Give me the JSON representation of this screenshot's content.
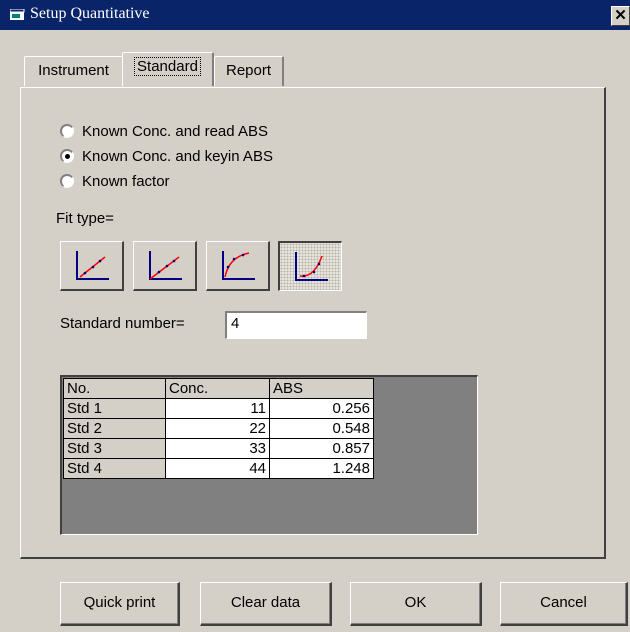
{
  "window": {
    "title": "Setup Quantitative",
    "close_symbol": "✕"
  },
  "tabs": [
    {
      "label": "Instrument",
      "active": false
    },
    {
      "label": "Standard",
      "active": true
    },
    {
      "label": "Report",
      "active": false
    }
  ],
  "mode_options": [
    {
      "label": "Known Conc. and read ABS",
      "checked": false
    },
    {
      "label": "Known Conc. and keyin ABS",
      "checked": true
    },
    {
      "label": "Known factor",
      "checked": false
    }
  ],
  "fit_type": {
    "label": "Fit type=",
    "buttons": [
      {
        "icon": "linear-fit-icon",
        "pressed": false
      },
      {
        "icon": "linear-through-origin-fit-icon",
        "pressed": false
      },
      {
        "icon": "quadratic-fit-icon",
        "pressed": false
      },
      {
        "icon": "cubic-fit-icon",
        "pressed": true
      }
    ],
    "curve_color": "#ff0000",
    "axis_color": "#000080"
  },
  "standard_number": {
    "label": "Standard number=",
    "value": "4"
  },
  "table": {
    "headers": [
      "No.",
      "Conc.",
      "ABS"
    ],
    "rows": [
      {
        "name": "Std 1",
        "conc": "11",
        "abs": "0.256"
      },
      {
        "name": "Std 2",
        "conc": "22",
        "abs": "0.548"
      },
      {
        "name": "Std 3",
        "conc": "33",
        "abs": "0.857"
      },
      {
        "name": "Std 4",
        "conc": "44",
        "abs": "1.248"
      }
    ]
  },
  "buttons": {
    "quick_print": "Quick print",
    "clear_data": "Clear data",
    "ok": "OK",
    "cancel": "Cancel"
  }
}
